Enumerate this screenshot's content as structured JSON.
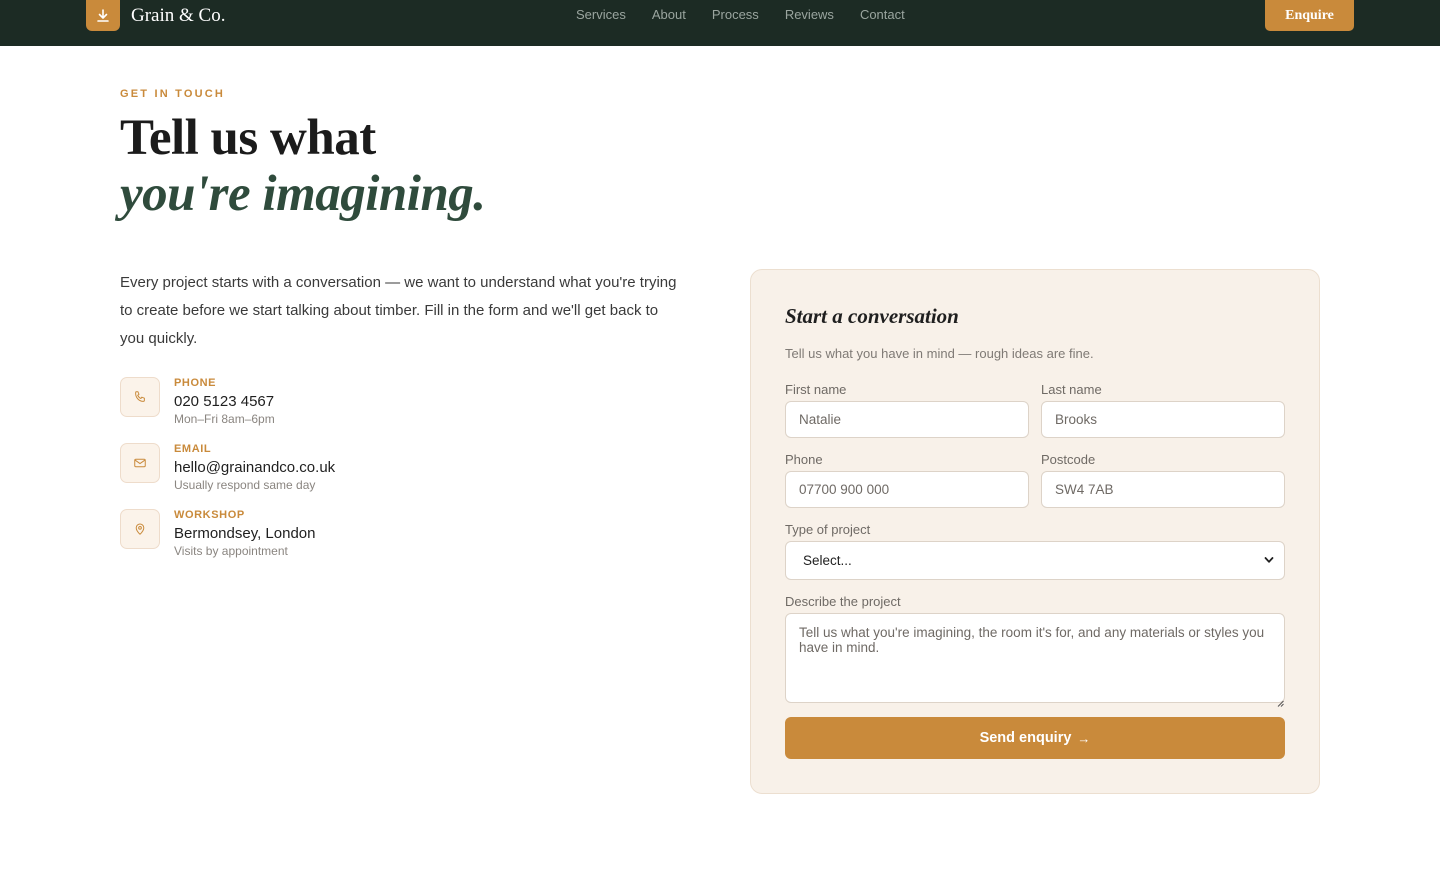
{
  "nav": {
    "brand_name": "Grain & Co.",
    "links": [
      "Services",
      "About",
      "Process",
      "Reviews",
      "Contact"
    ],
    "cta_label": "Enquire"
  },
  "hero": {
    "eyebrow": "GET IN TOUCH",
    "headline_line1": "Tell us what",
    "headline_line2": "you're imagining.",
    "intro": "Every project starts with a conversation — we want to understand what you're trying to create before we start talking about timber. Fill in the form and we'll get back to you quickly."
  },
  "contacts": [
    {
      "icon": "phone-icon",
      "label": "PHONE",
      "value": "020 5123 4567",
      "note": "Mon–Fri 8am–6pm"
    },
    {
      "icon": "mail-icon",
      "label": "EMAIL",
      "value": "hello@grainandco.co.uk",
      "note": "Usually respond same day"
    },
    {
      "icon": "map-pin-icon",
      "label": "WORKSHOP",
      "value": "Bermondsey, London",
      "note": "Visits by appointment"
    }
  ],
  "form": {
    "title": "Start a conversation",
    "subtitle": "Tell us what you have in mind — rough ideas are fine.",
    "first_name": {
      "label": "First name",
      "placeholder": "Natalie"
    },
    "last_name": {
      "label": "Last name",
      "placeholder": "Brooks"
    },
    "phone": {
      "label": "Phone",
      "placeholder": "07700 900 000"
    },
    "postcode": {
      "label": "Postcode",
      "placeholder": "SW4 7AB"
    },
    "project_type": {
      "label": "Type of project",
      "selected": "Select..."
    },
    "description": {
      "label": "Describe the project",
      "placeholder": "Tell us what you're imagining, the room it's for, and any materials or styles you have in mind."
    },
    "submit_label": "Send enquiry",
    "submit_arrow": "→"
  },
  "colors": {
    "nav_bg": "#1c2b24",
    "accent": "#c98a3b",
    "headline_accent": "#2f4b3c",
    "card_bg": "#f8f1e9"
  }
}
